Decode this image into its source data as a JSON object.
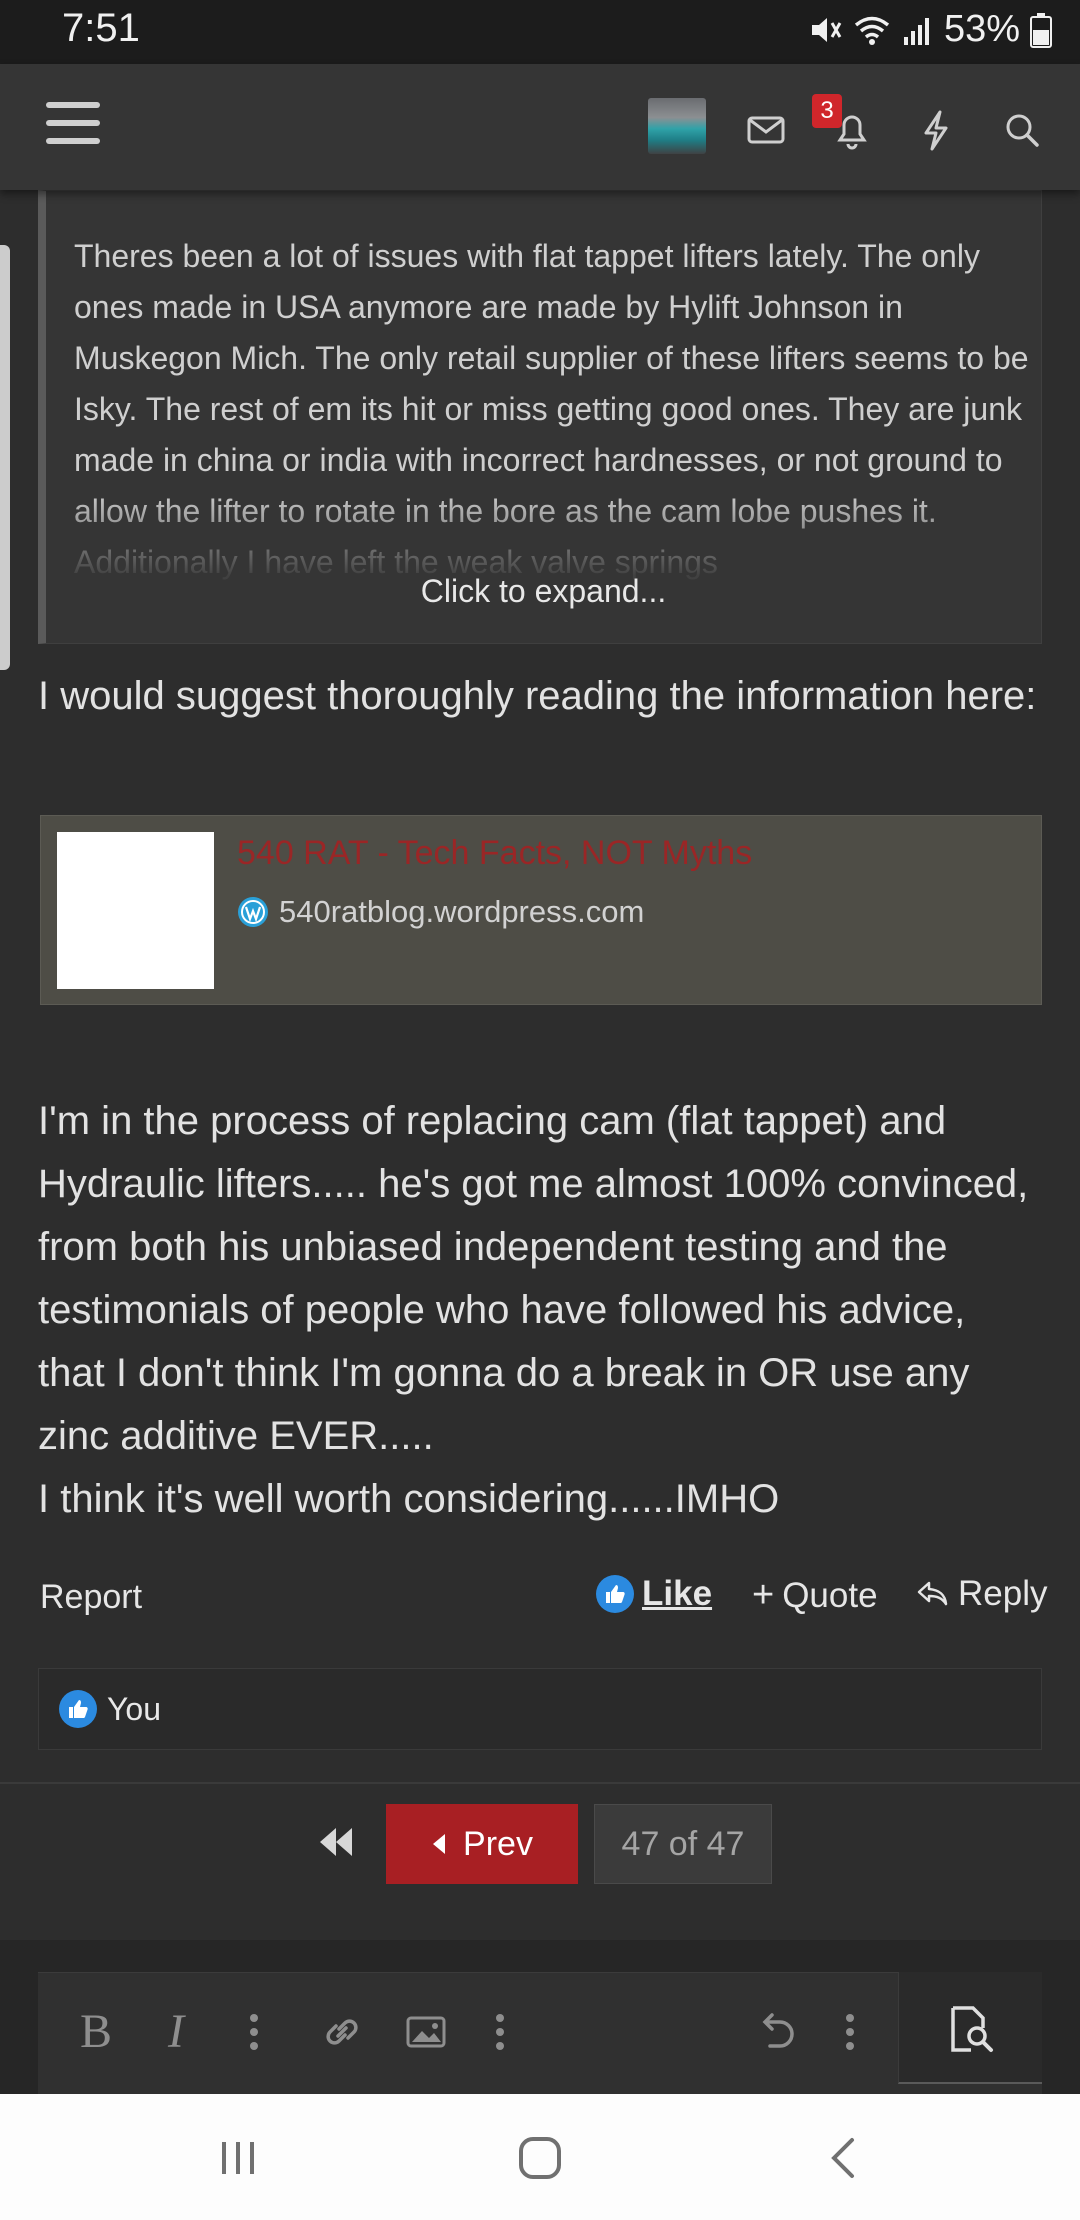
{
  "status_bar": {
    "time": "7:51",
    "battery": "53%"
  },
  "header": {
    "notification_count": "3",
    "icons": [
      "menu-icon",
      "avatar",
      "mail-icon",
      "bell-icon",
      "bolt-icon",
      "search-icon"
    ]
  },
  "quote": {
    "text": "Theres been a lot of issues with flat tappet lifters lately. The only ones made in USA anymore are made by Hylift Johnson in Muskegon Mich. The only retail supplier of these lifters seems to be Isky. The rest of em its hit or miss getting good ones. They are junk made in china or india with incorrect hardnesses, or not ground to allow the lifter to rotate in the bore as the cam lobe pushes it. Additionally I have left the weak valve springs",
    "expand_label": "Click to expand..."
  },
  "post": {
    "intro": "I would suggest thoroughly reading the information here:",
    "link": {
      "title": "540 RAT - Tech Facts, NOT Myths",
      "site": "540ratblog.wordpress.com"
    },
    "body": "I'm in the process of replacing cam (flat tappet) and Hydraulic lifters..... he's got me almost 100% convinced, from both his unbiased independent testing and the testimonials of people who have followed his advice, that I don't think I'm gonna do a break in OR use any zinc additive EVER.....",
    "closing": "I think it's well worth considering......IMHO"
  },
  "actions": {
    "report": "Report",
    "like": "Like",
    "quote": "Quote",
    "reply": "Reply"
  },
  "likes": {
    "text": "You"
  },
  "pagination": {
    "prev": "Prev",
    "page": "47 of 47"
  },
  "colors": {
    "accent_red": "#a81f23",
    "like_blue": "#2b8ae0",
    "background": "#2d2d2d"
  }
}
